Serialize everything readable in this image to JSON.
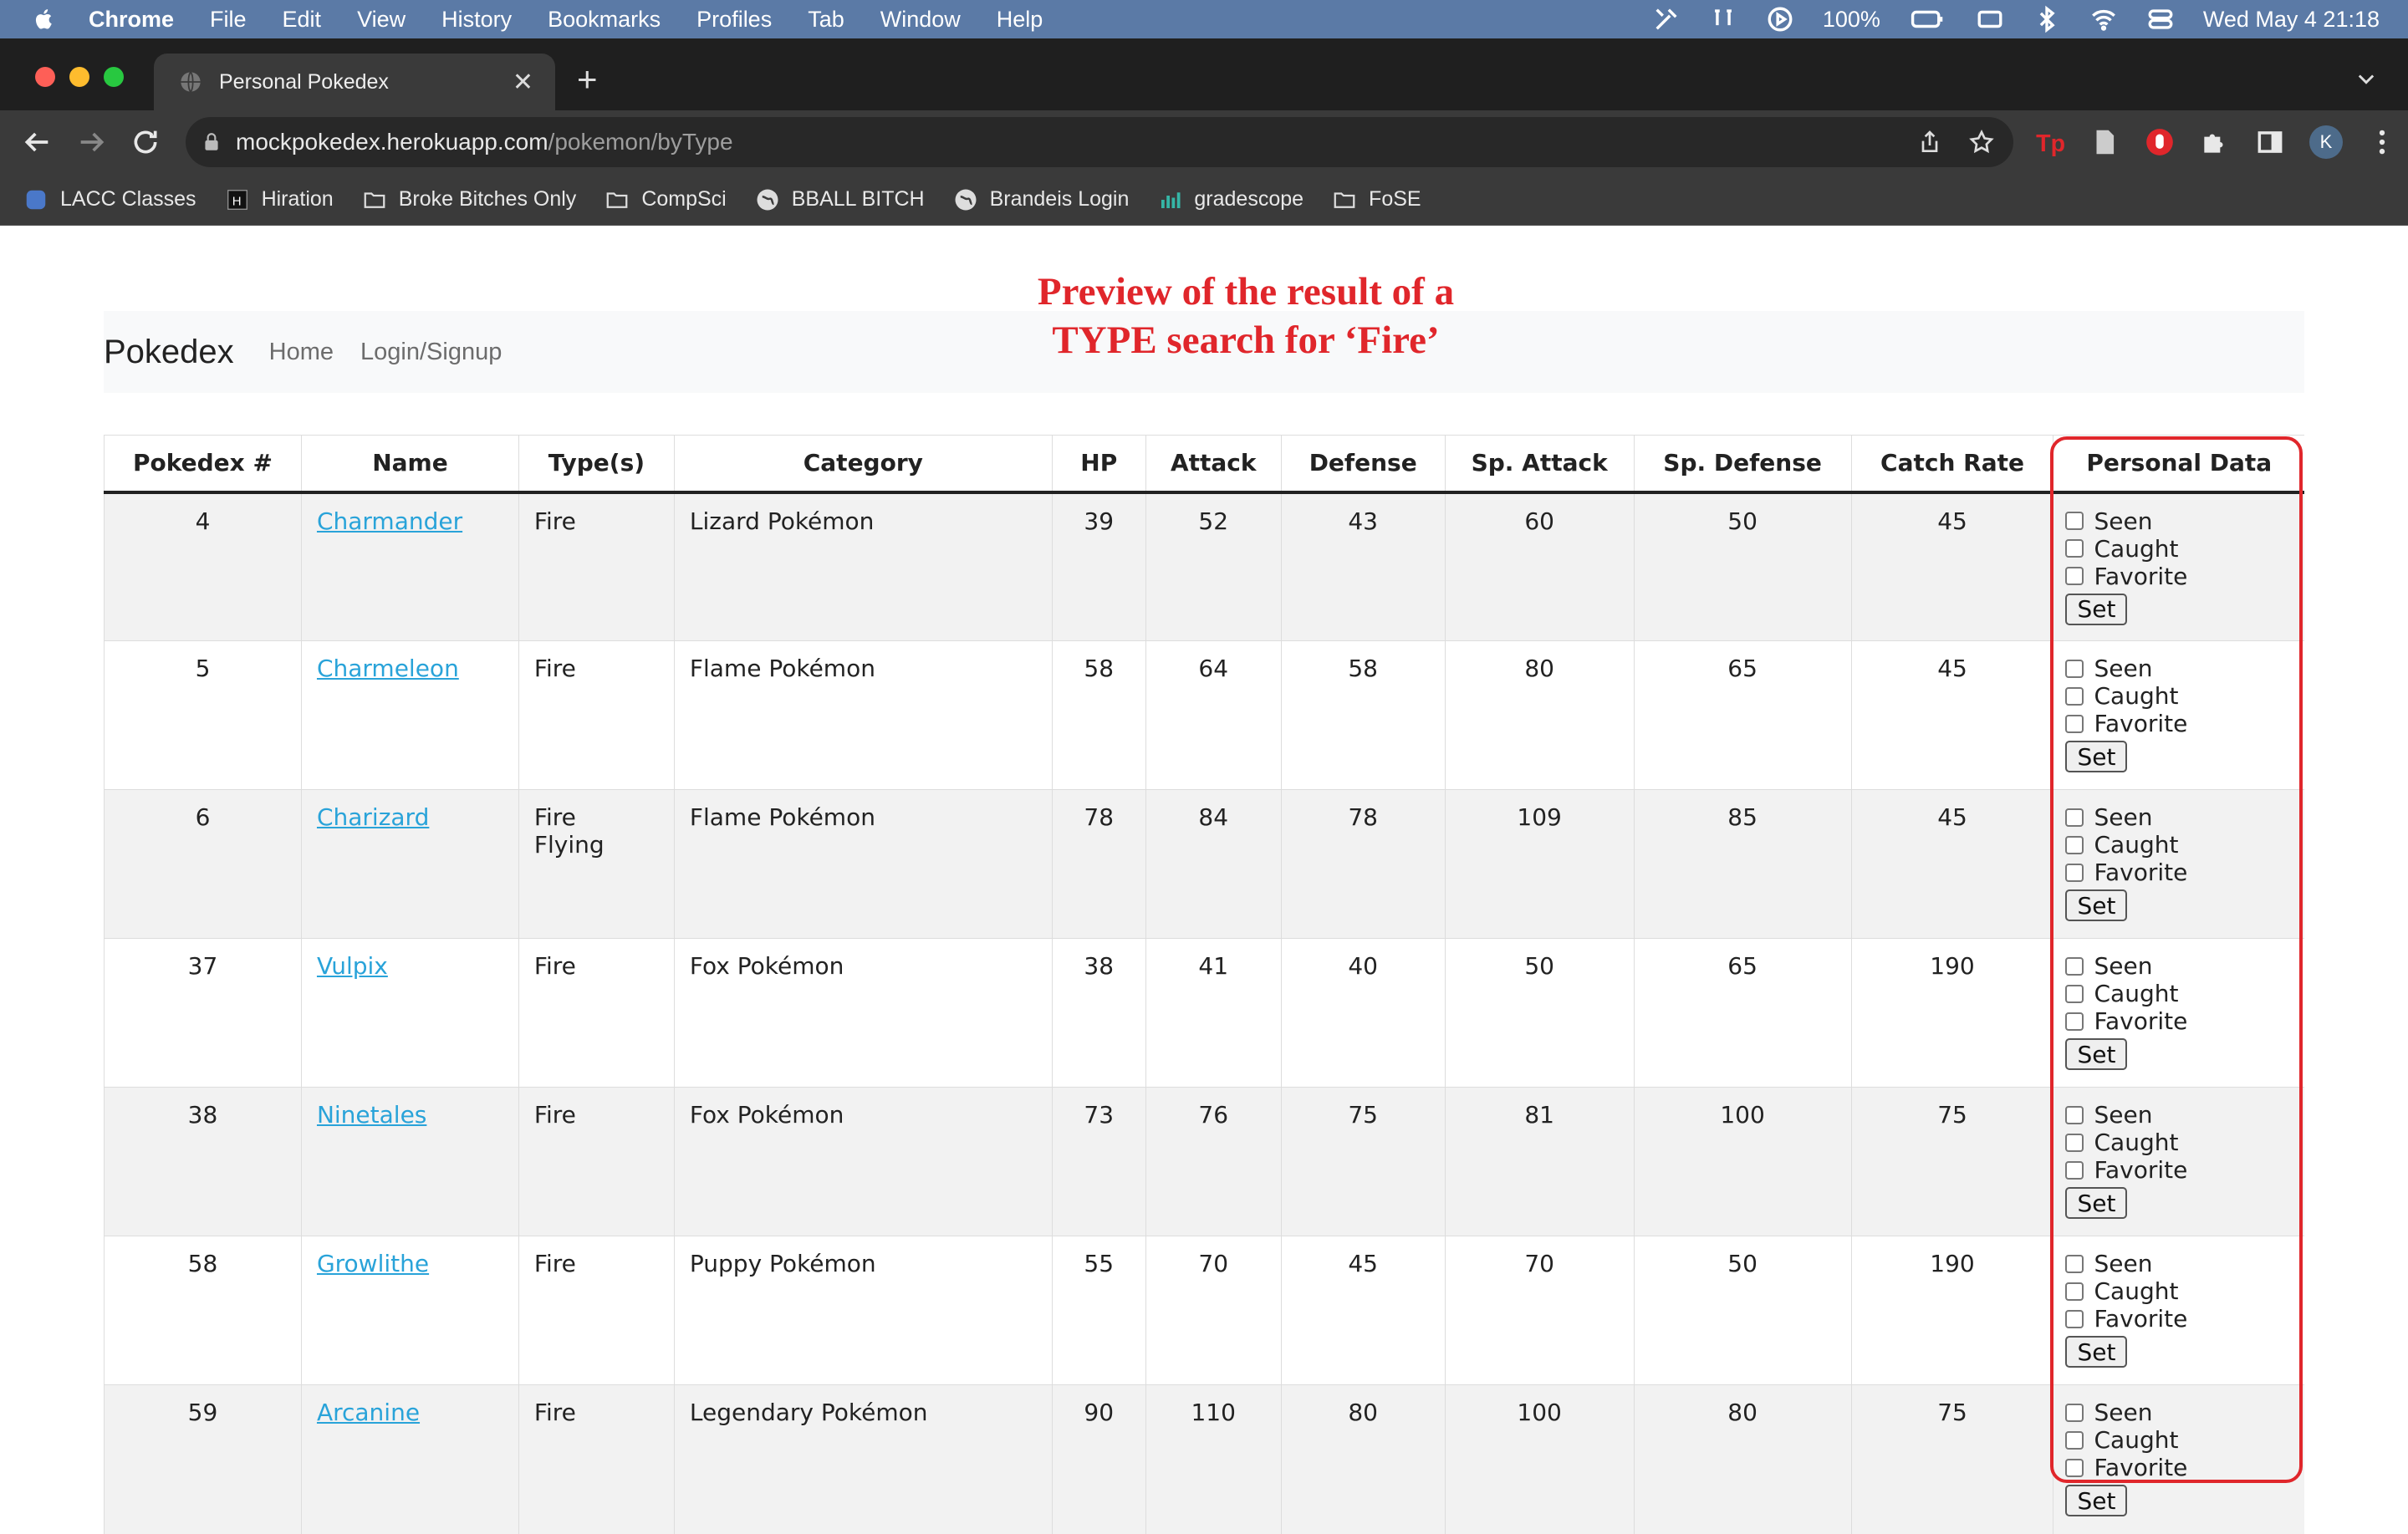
{
  "menubar": {
    "items": [
      "Chrome",
      "File",
      "Edit",
      "View",
      "History",
      "Bookmarks",
      "Profiles",
      "Tab",
      "Window",
      "Help"
    ],
    "battery": "100%",
    "datetime": "Wed May 4  21:18"
  },
  "browser": {
    "tab_title": "Personal Pokedex",
    "url_host": "mockpokedex.herokuapp.com",
    "url_path": "/pokemon/byType",
    "avatar_letter": "K",
    "bookmarks": [
      "LACC Classes",
      "Hiration",
      "Broke Bitches Only",
      "CompSci",
      "BBALL BITCH",
      "Brandeis Login",
      "gradescope",
      "FoSE"
    ]
  },
  "annotation": {
    "line1": "Preview of the result of a",
    "line2": "TYPE search for ‘Fire’"
  },
  "nav": {
    "brand": "Pokedex",
    "home": "Home",
    "login": "Login/Signup"
  },
  "table": {
    "headers": [
      "Pokedex #",
      "Name",
      "Type(s)",
      "Category",
      "HP",
      "Attack",
      "Defense",
      "Sp. Attack",
      "Sp. Defense",
      "Catch Rate",
      "Personal Data"
    ],
    "checkbox_labels": {
      "seen": "Seen",
      "caught": "Caught",
      "favorite": "Favorite",
      "set": "Set"
    },
    "rows": [
      {
        "num": "4",
        "name": "Charmander",
        "type1": "Fire",
        "type2": "",
        "category": "Lizard Pokémon",
        "hp": "39",
        "attack": "52",
        "defense": "43",
        "spatk": "60",
        "spdef": "50",
        "catch": "45"
      },
      {
        "num": "5",
        "name": "Charmeleon",
        "type1": "Fire",
        "type2": "",
        "category": "Flame Pokémon",
        "hp": "58",
        "attack": "64",
        "defense": "58",
        "spatk": "80",
        "spdef": "65",
        "catch": "45"
      },
      {
        "num": "6",
        "name": "Charizard",
        "type1": "Fire",
        "type2": "Flying",
        "category": "Flame Pokémon",
        "hp": "78",
        "attack": "84",
        "defense": "78",
        "spatk": "109",
        "spdef": "85",
        "catch": "45"
      },
      {
        "num": "37",
        "name": "Vulpix",
        "type1": "Fire",
        "type2": "",
        "category": "Fox Pokémon",
        "hp": "38",
        "attack": "41",
        "defense": "40",
        "spatk": "50",
        "spdef": "65",
        "catch": "190"
      },
      {
        "num": "38",
        "name": "Ninetales",
        "type1": "Fire",
        "type2": "",
        "category": "Fox Pokémon",
        "hp": "73",
        "attack": "76",
        "defense": "75",
        "spatk": "81",
        "spdef": "100",
        "catch": "75"
      },
      {
        "num": "58",
        "name": "Growlithe",
        "type1": "Fire",
        "type2": "",
        "category": "Puppy Pokémon",
        "hp": "55",
        "attack": "70",
        "defense": "45",
        "spatk": "70",
        "spdef": "50",
        "catch": "190"
      },
      {
        "num": "59",
        "name": "Arcanine",
        "type1": "Fire",
        "type2": "",
        "category": "Legendary Pokémon",
        "hp": "90",
        "attack": "110",
        "defense": "80",
        "spatk": "100",
        "spdef": "80",
        "catch": "75"
      }
    ]
  },
  "colors": {
    "annotation": "#e0262b",
    "link": "#29a3d9",
    "menubar": "#5b7aa6"
  }
}
